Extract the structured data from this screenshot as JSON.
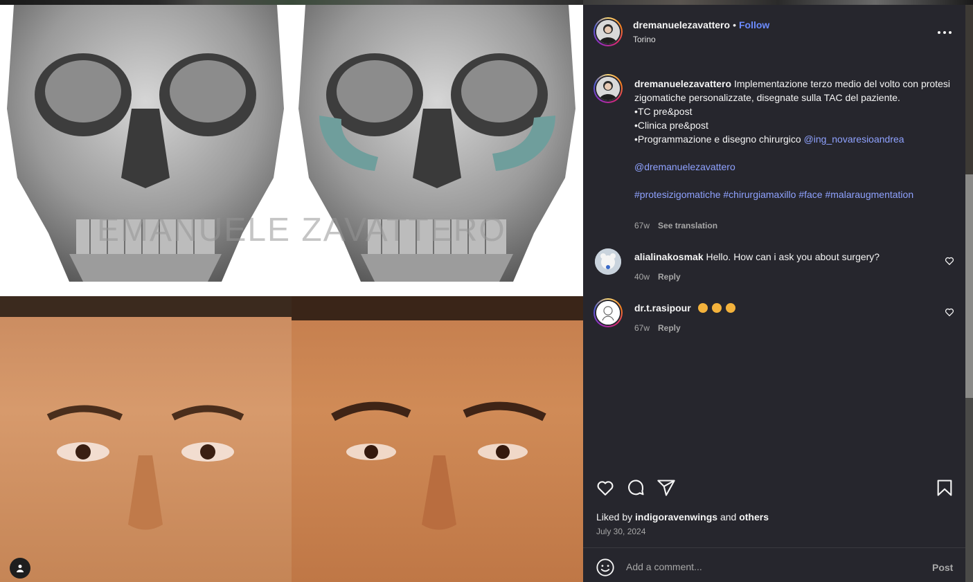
{
  "post": {
    "author": "dremanuelezavattero",
    "follow_label": "Follow",
    "separator": "•",
    "location": "Torino"
  },
  "media": {
    "watermark": "EMANUELE ZAVATTERO"
  },
  "caption": {
    "author": "dremanuelezavattero",
    "text": "Implementazione terzo medio del volto con protesi zigomatiche personalizzate, disegnate sulla TAC del paziente.",
    "bullet1": "•TC pre&post",
    "bullet2": "•Clinica pre&post",
    "bullet3": "•Programmazione e disegno chirurgico",
    "mention1": "@ing_novaresioandrea",
    "mention2": "@dremanuelezavattero",
    "hashtags": "#protesizigomatiche #chirurgiamaxillo #face #malaraugmentation",
    "time": "67w",
    "see_translation": "See translation"
  },
  "comments": [
    {
      "user": "alialinakosmak",
      "text": "Hello. How can i ask you about surgery?",
      "time": "40w",
      "reply": "Reply"
    },
    {
      "user": "dr.t.rasipour",
      "text": "",
      "time": "67w",
      "reply": "Reply"
    }
  ],
  "likes": {
    "prefix": "Liked by",
    "user": "indigoravenwings",
    "and": "and",
    "others": "others"
  },
  "date": "July 30, 2024",
  "comment_box": {
    "placeholder": "Add a comment...",
    "post_label": "Post"
  },
  "icons": {
    "heart": "heart-icon",
    "comment": "comment-icon",
    "share": "share-icon",
    "save": "bookmark-icon",
    "more": "more-icon",
    "emoji": "emoji-icon",
    "user_tag": "user-tag-icon"
  },
  "colors": {
    "panel_bg": "#26262d",
    "link": "#8fa2ff",
    "follow": "#6c8cff",
    "muted": "#a8a8a8",
    "implant": "#6f9e9c"
  }
}
